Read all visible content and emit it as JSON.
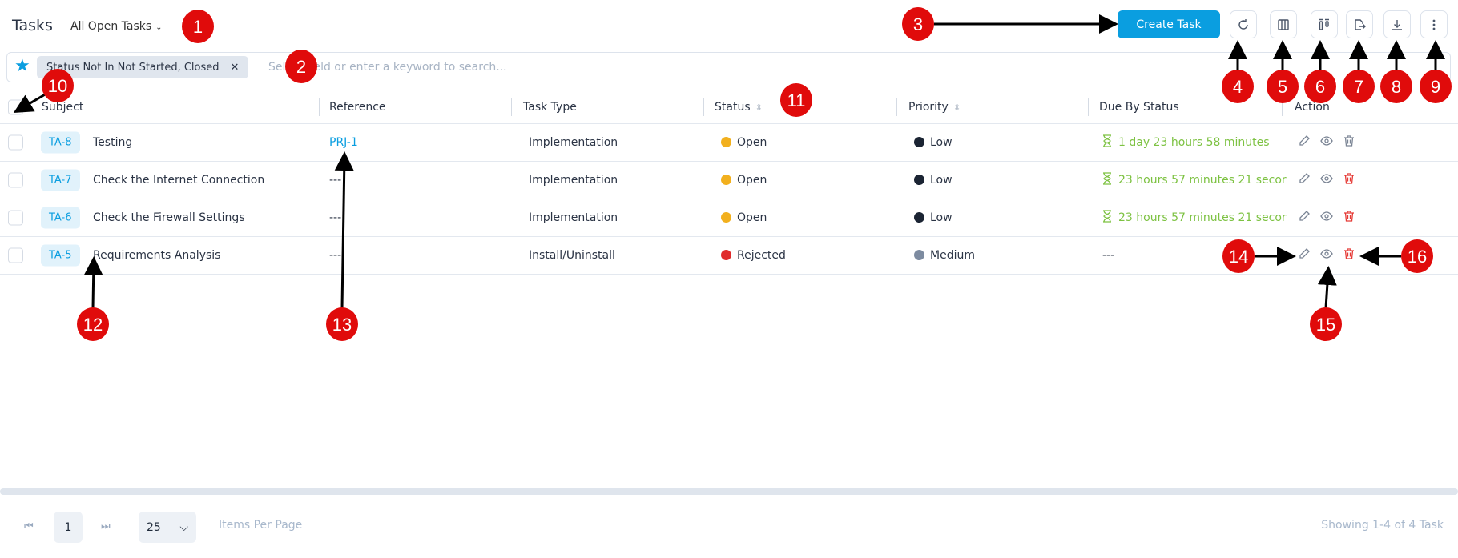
{
  "header": {
    "title": "Tasks",
    "view_label": "All Open Tasks",
    "create_label": "Create Task",
    "toolbar_icons": [
      "refresh-icon",
      "columns-icon",
      "layout-icon",
      "export-icon",
      "download-icon",
      "more-vertical-icon"
    ]
  },
  "search": {
    "filter_chip": "Status Not In Not Started, Closed",
    "placeholder": "Select field or enter a keyword to search..."
  },
  "columns": [
    "Subject",
    "Reference",
    "Task Type",
    "Status",
    "Priority",
    "Due By Status",
    "Action"
  ],
  "rows": [
    {
      "id": "TA-8",
      "subject": "Testing",
      "reference": "PRJ-1",
      "type": "Implementation",
      "status": "Open",
      "status_color": "#f2b01e",
      "priority": "Low",
      "priority_color": "#1b2433",
      "due": "1 day 23 hours 58 minutes",
      "trash_color": "#7a8494"
    },
    {
      "id": "TA-7",
      "subject": "Check the Internet Connection",
      "reference": "---",
      "type": "Implementation",
      "status": "Open",
      "status_color": "#f2b01e",
      "priority": "Low",
      "priority_color": "#1b2433",
      "due": "23 hours 57 minutes 21 secor",
      "trash_color": "#e53935"
    },
    {
      "id": "TA-6",
      "subject": "Check the Firewall Settings",
      "reference": "---",
      "type": "Implementation",
      "status": "Open",
      "status_color": "#f2b01e",
      "priority": "Low",
      "priority_color": "#1b2433",
      "due": "23 hours 57 minutes 21 secor",
      "trash_color": "#e53935"
    },
    {
      "id": "TA-5",
      "subject": "Requirements Analysis",
      "reference": "---",
      "type": "Install/Uninstall",
      "status": "Rejected",
      "status_color": "#e02c2c",
      "priority": "Medium",
      "priority_color": "#7d8ba0",
      "due": "---",
      "trash_color": "#e53935"
    }
  ],
  "footer": {
    "page": "1",
    "per_page": "25",
    "items_per_page_label": "Items Per Page",
    "showing": "Showing 1-4 of 4 Task"
  },
  "annotations": [
    "1",
    "2",
    "3",
    "4",
    "5",
    "6",
    "7",
    "8",
    "9",
    "10",
    "11",
    "12",
    "13",
    "14",
    "15",
    "16"
  ],
  "colors": {
    "accent": "#0a9ee0",
    "due": "#7dc242",
    "annotation": "#e00b0b"
  }
}
